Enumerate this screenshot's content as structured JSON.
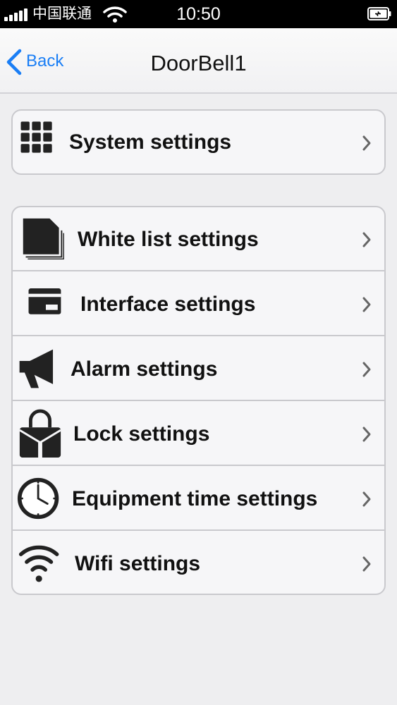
{
  "status_bar": {
    "carrier": "中国联通",
    "time": "10:50",
    "signal_icon": "signal-bars-icon",
    "wifi_icon": "wifi-status-icon",
    "battery_icon": "battery-charging-icon"
  },
  "nav": {
    "back_label": "Back",
    "title": "DoorBell1"
  },
  "colors": {
    "accent": "#1a7ef5",
    "background": "#eeeef0",
    "row_background": "#f6f6f8",
    "separator": "#c9c9cd"
  },
  "groups": [
    {
      "items": [
        {
          "label": "System settings",
          "icon": "grid-icon"
        }
      ]
    },
    {
      "items": [
        {
          "label": "White list settings",
          "icon": "card-stack-icon"
        },
        {
          "label": "Interface settings",
          "icon": "card-icon"
        },
        {
          "label": "Alarm settings",
          "icon": "megaphone-icon"
        },
        {
          "label": "Lock settings",
          "icon": "padlock-icon"
        },
        {
          "label": "Equipment time settings",
          "icon": "clock-icon"
        },
        {
          "label": "Wifi settings",
          "icon": "wifi-icon"
        }
      ]
    }
  ]
}
